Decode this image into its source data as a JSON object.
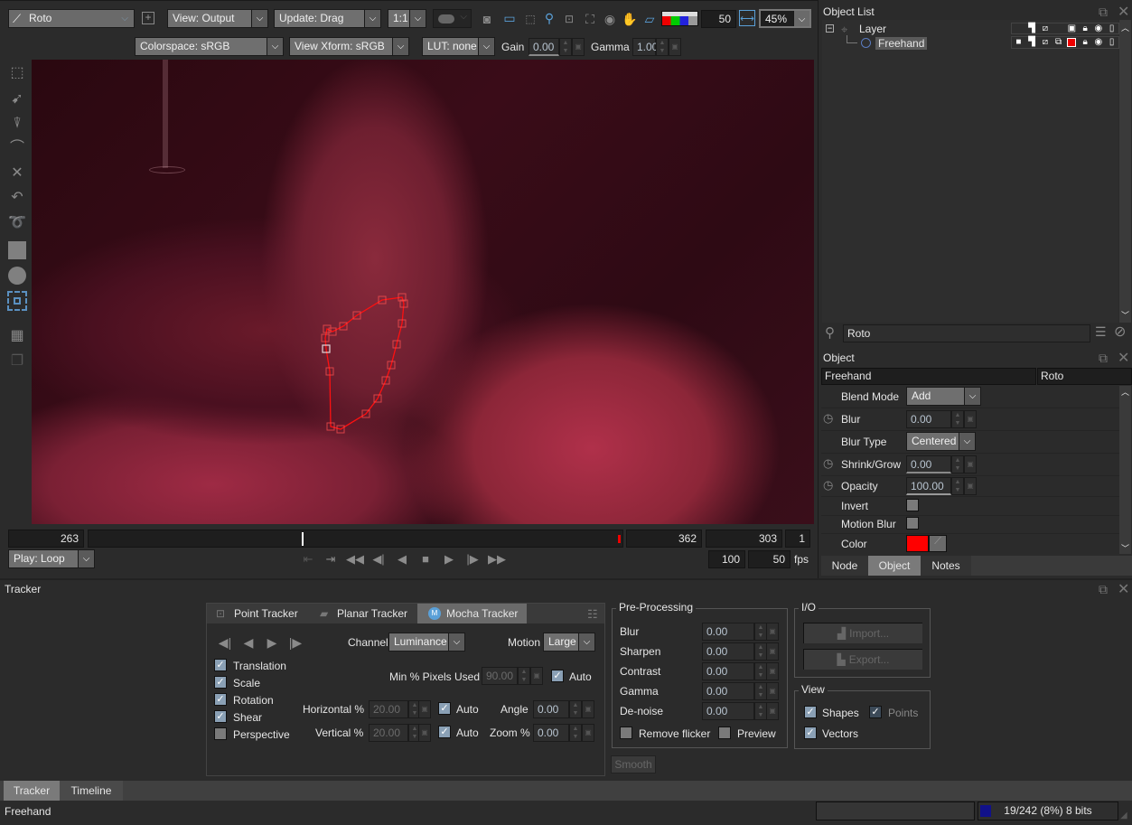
{
  "toolbar": {
    "tool_select": "Roto",
    "view": "View: Output",
    "update": "Update: Drag",
    "zoom_ratio": "1:1",
    "brightness_value": "50",
    "zoom_percent": "45%",
    "colorspace": "Colorspace: sRGB",
    "view_xform": "View Xform: sRGB",
    "lut": "LUT: none",
    "gain_label": "Gain",
    "gain_value": "0.00",
    "gamma_label": "Gamma",
    "gamma_value": "1.00",
    "icons": [
      "add-icon",
      "mask-toggle-icon",
      "camera-icon",
      "monitor-icon",
      "grid-icon",
      "magnifier-icon",
      "frame-icon",
      "fit-icon",
      "orbit-icon",
      "hand-icon",
      "overlay-icon",
      "rgb-channels-icon",
      "fit-width-icon"
    ]
  },
  "left_tools": [
    "transform-icon",
    "select-icon",
    "add-point-icon",
    "bezier-icon",
    "remove-point-icon",
    "curve-icon",
    "lasso-icon",
    "rectangle-icon",
    "ellipse-icon",
    "tracker-box-icon",
    "edit-clip-icon",
    "layers-icon"
  ],
  "timeline": {
    "start_frame": "263",
    "end_frame": "362",
    "current_frame": "303",
    "step": "1",
    "current_position": 0.4,
    "play_mode": "Play: Loop",
    "speed": "100",
    "fps_value": "50",
    "fps_label": "fps"
  },
  "object_list": {
    "title": "Object List",
    "items": [
      {
        "name": "Layer",
        "type": "layer"
      },
      {
        "name": "Freehand",
        "type": "shape",
        "color": "#ff0000"
      }
    ],
    "search_value": "Roto"
  },
  "object_panel": {
    "title": "Object",
    "header_left": "Freehand",
    "header_right": "Roto",
    "properties": [
      {
        "label": "Blend Mode",
        "value": "Add",
        "kind": "dropdown"
      },
      {
        "label": "Blur",
        "value": "0.00",
        "kind": "number",
        "animatable": true
      },
      {
        "label": "Blur Type",
        "value": "Centered",
        "kind": "dropdown"
      },
      {
        "label": "Shrink/Grow",
        "value": "0.00",
        "kind": "number",
        "animatable": true
      },
      {
        "label": "Opacity",
        "value": "100.00",
        "kind": "number",
        "animatable": true
      },
      {
        "label": "Invert",
        "value": false,
        "kind": "checkbox"
      },
      {
        "label": "Motion Blur",
        "value": false,
        "kind": "checkbox"
      },
      {
        "label": "Color",
        "value": "#ff0000",
        "kind": "color"
      }
    ],
    "tabs": [
      "Node",
      "Object",
      "Notes"
    ],
    "active_tab": "Object"
  },
  "tracker": {
    "title": "Tracker",
    "tabs": [
      "Point Tracker",
      "Planar Tracker",
      "Mocha Tracker"
    ],
    "active_tab": "Mocha Tracker",
    "channel_label": "Channel",
    "channel": "Luminance",
    "motion_label": "Motion",
    "motion": "Large",
    "motion_types": [
      {
        "label": "Translation",
        "checked": true
      },
      {
        "label": "Scale",
        "checked": true
      },
      {
        "label": "Rotation",
        "checked": true
      },
      {
        "label": "Shear",
        "checked": true
      },
      {
        "label": "Perspective",
        "checked": false
      }
    ],
    "min_pixels_label": "Min % Pixels Used",
    "min_pixels": "90.00",
    "horizontal_label": "Horizontal %",
    "horizontal": "20.00",
    "vertical_label": "Vertical %",
    "vertical": "20.00",
    "auto_label": "Auto",
    "angle_label": "Angle",
    "angle": "0.00",
    "zoom_label": "Zoom %",
    "zoom": "0.00",
    "preprocessing": {
      "title": "Pre-Processing",
      "rows": [
        {
          "label": "Blur",
          "value": "0.00"
        },
        {
          "label": "Sharpen",
          "value": "0.00"
        },
        {
          "label": "Contrast",
          "value": "0.00"
        },
        {
          "label": "Gamma",
          "value": "0.00"
        },
        {
          "label": "De-noise",
          "value": "0.00"
        }
      ],
      "remove_flicker": "Remove flicker",
      "preview": "Preview"
    },
    "io": {
      "title": "I/O",
      "import": "Import...",
      "export": "Export..."
    },
    "view": {
      "title": "View",
      "shapes": "Shapes",
      "points": "Points",
      "vectors": "Vectors"
    },
    "smooth": "Smooth"
  },
  "bottom_tabs": [
    "Tracker",
    "Timeline"
  ],
  "bottom_active": "Tracker",
  "status": {
    "left": "Freehand",
    "cache": "19/242 (8%) 8 bits",
    "cache_fraction": 0.08
  }
}
